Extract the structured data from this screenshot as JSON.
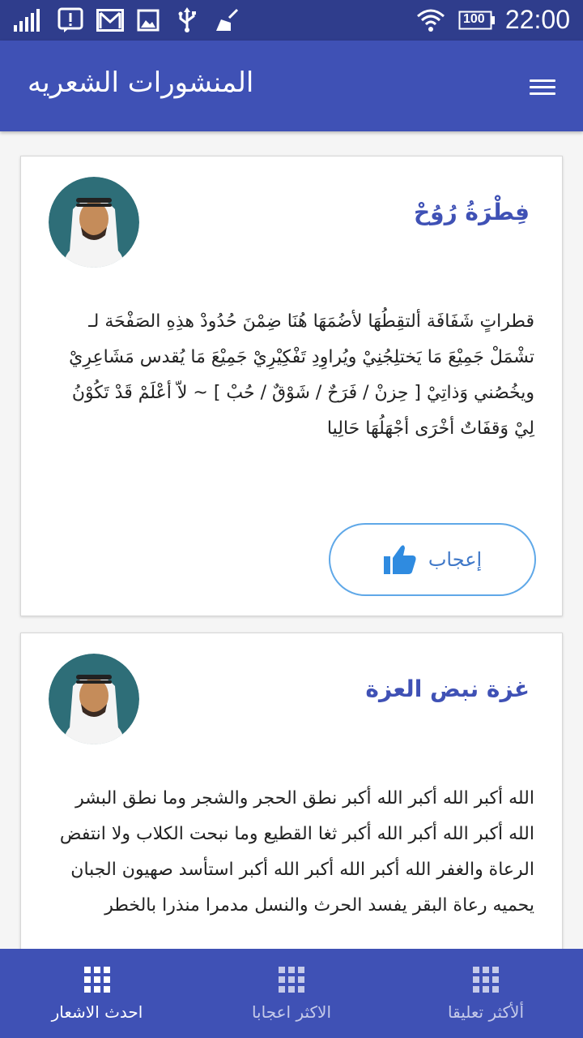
{
  "status_bar": {
    "time": "22:00",
    "battery": "100",
    "icons": [
      "signal-icon",
      "alert-icon",
      "gmail-icon",
      "image-icon",
      "usb-icon",
      "cleaner-icon",
      "wifi-icon",
      "battery-icon"
    ]
  },
  "app_bar": {
    "title": "المنشورات الشعريه",
    "menu_icon": "hamburger-menu-icon"
  },
  "posts": [
    {
      "author": "فِطْرَةُ رُوُحْ",
      "body": "قطراتٍ شَفَافَة ألتقِطُهَا لأضُمَهَا هُنَا ضِمْنَ حُدُودْ هذِهِ الصَفْحَة لـ تشْمَلْ جَمِيْعَ مَا يَختلِجُنِيْ ويُراوِدِ تَفْكِيْرِيْ جَمِيْعَ مَا يُقدس مَشَاعِرِيْ ويخُصُني وَذاتِيْ [ حِزنْ / فَرَحٌ / شَوْقٌ / حُبْ ] ~ لاّ أعْلَمْ قَدْ تَكُوْنُ لِيْ وَقفَاتٌ أخْرَى أجْهَلُهَا حَالِيا",
      "like_label": "إعجاب",
      "avatar_icon": "avatar-icon"
    },
    {
      "author": "غزة نبض العزة",
      "body": "الله أكبر الله أكبر الله أكبر  نطق الحجر والشجر وما نطق البشر  الله أكبر الله أكبر الله أكبر  ثغا القطيع وما نبحت الكلاب  ولا انتفض الرعاة والغفر  الله أكبر الله أكبر الله أكبر  استأسد صهيون الجبان يحميه رعاة البقر  يفسد الحرث والنسل  مدمرا منذرا بالخطر",
      "avatar_icon": "avatar-icon"
    }
  ],
  "bottom_nav": [
    {
      "label": "احدث الاشعار",
      "icon": "grid-icon",
      "active": true
    },
    {
      "label": "الاكثر اعجابا",
      "icon": "grid-icon",
      "active": false
    },
    {
      "label": "ألأكثر تعليقا",
      "icon": "grid-icon",
      "active": false
    }
  ],
  "colors": {
    "status_bar": "#2f3d8c",
    "primary": "#3f51b5",
    "title_text": "#3f51b5",
    "like_border": "#5fa8e8",
    "like_icon": "#2f8be0"
  }
}
